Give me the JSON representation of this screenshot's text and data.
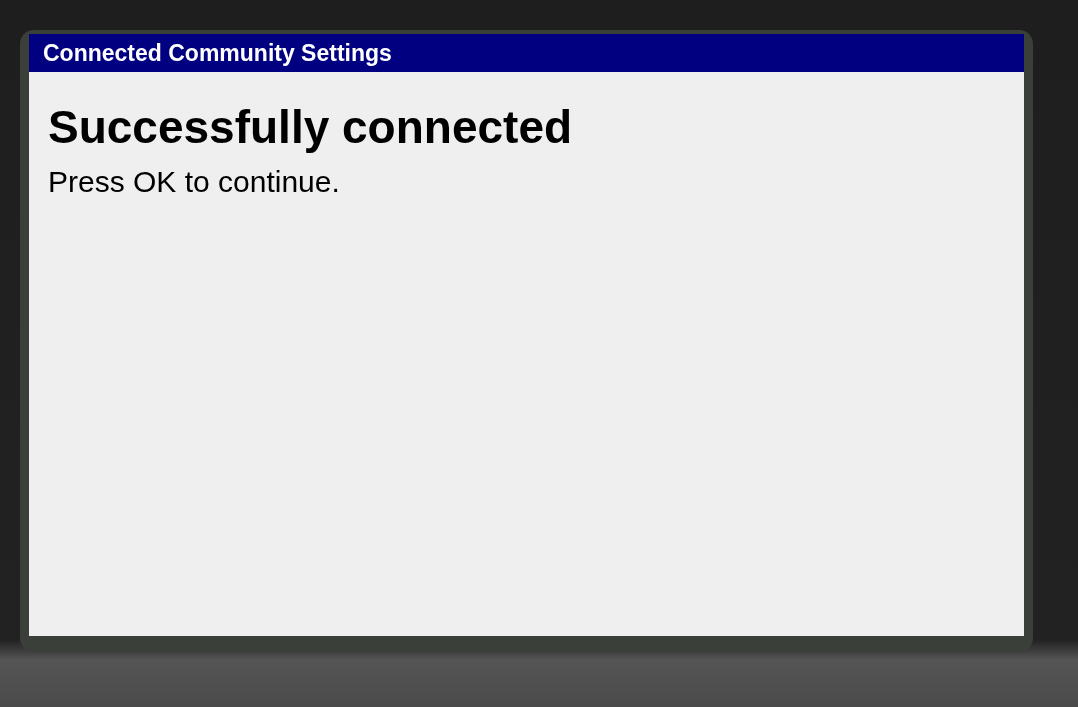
{
  "window": {
    "title": "Connected Community Settings"
  },
  "message": {
    "heading": "Successfully connected",
    "text": "Press OK to continue."
  }
}
